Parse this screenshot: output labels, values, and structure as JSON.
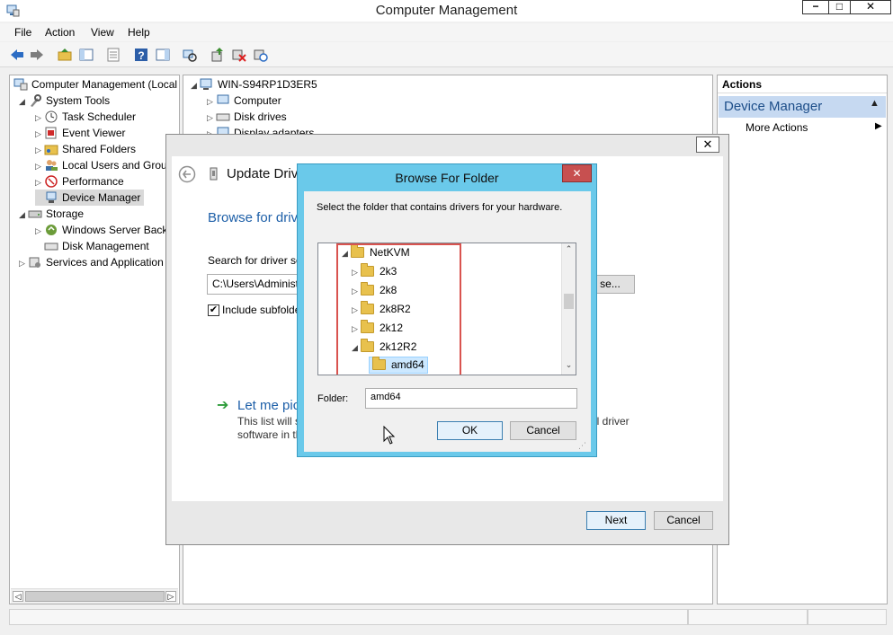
{
  "window": {
    "title": "Computer Management",
    "minimize_glyph": "−",
    "maximize_glyph": "□",
    "close_glyph": "✕"
  },
  "menu": [
    "File",
    "Action",
    "View",
    "Help"
  ],
  "tree": {
    "root": "Computer Management (Local",
    "system_tools": "System Tools",
    "task_scheduler": "Task Scheduler",
    "event_viewer": "Event Viewer",
    "shared_folders": "Shared Folders",
    "local_users": "Local Users and Grou",
    "performance": "Performance",
    "device_manager": "Device Manager",
    "storage": "Storage",
    "windows_server_backup": "Windows Server Back",
    "disk_management": "Disk Management",
    "services_apps": "Services and Application"
  },
  "center": {
    "computer_name": "WIN-S94RP1D3ER5",
    "computer": "Computer",
    "disk_drives": "Disk drives",
    "display_adapters": "Display adapters"
  },
  "actions": {
    "header": "Actions",
    "section": "Device Manager",
    "more_actions": "More Actions"
  },
  "wizard": {
    "title": "Update Driv",
    "heading": "Browse for driv",
    "search_label": "Search for driver so",
    "path_value": "C:\\Users\\Administ",
    "browse_label": "se...",
    "include_subfolders": "Include subfolde",
    "let_me_pick": "Let me pic",
    "desc_line1": "This list will s",
    "desc_line1_right": "ll driver",
    "desc_line2": "software in th",
    "next_label": "Next",
    "cancel_label": "Cancel"
  },
  "browse": {
    "title": "Browse For Folder",
    "instruction": "Select the folder that contains drivers for your hardware.",
    "folders": [
      "NetKVM",
      "2k3",
      "2k8",
      "2k8R2",
      "2k12",
      "2k12R2",
      "amd64"
    ],
    "folder_label": "Folder:",
    "folder_value": "amd64",
    "ok_label": "OK",
    "cancel_label": "Cancel"
  },
  "colors": {
    "dialog_frame": "#6ac9ea",
    "highlight_border": "#d9534f",
    "accent_blue": "#1d5fa8"
  }
}
